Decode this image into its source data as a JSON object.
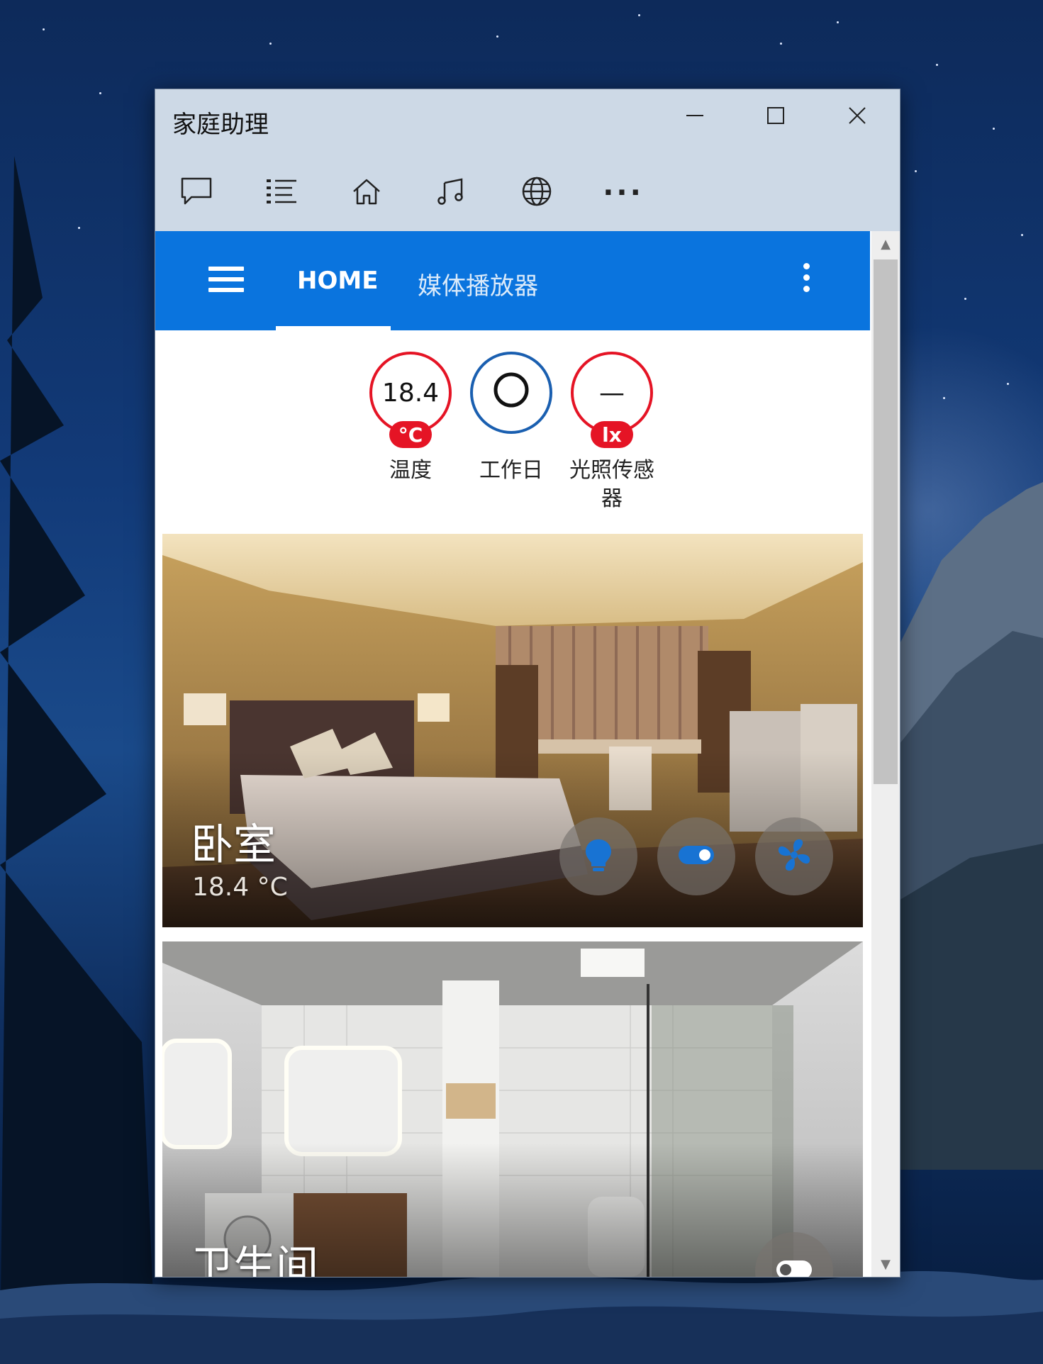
{
  "window": {
    "title": "家庭助理",
    "minimize_icon": "minimize-icon",
    "maximize_icon": "maximize-icon",
    "close_icon": "close-icon"
  },
  "toolbar": [
    {
      "name": "chat-icon"
    },
    {
      "name": "list-icon"
    },
    {
      "name": "home-icon"
    },
    {
      "name": "music-icon"
    },
    {
      "name": "globe-icon"
    },
    {
      "name": "more-icon",
      "glyph": "···"
    }
  ],
  "appbar": {
    "tabs": [
      "HOME",
      "媒体播放器"
    ],
    "active_tab": "HOME",
    "accent": "#0a74de"
  },
  "badges": [
    {
      "value": "18.4",
      "unit": "°C",
      "label": "温度",
      "ring": "#e51425"
    },
    {
      "value": "",
      "unit": "",
      "label": "工作日",
      "ring": "#1a5fb0"
    },
    {
      "value": "—",
      "unit": "lx",
      "label": "光照传感器",
      "ring": "#e51425"
    }
  ],
  "cards": [
    {
      "name": "卧室",
      "temperature": "18.4 °C",
      "actions": [
        "light-bulb-icon",
        "toggle-icon",
        "fan-icon"
      ]
    },
    {
      "name": "卫生间",
      "actions": [
        "toggle-icon"
      ]
    }
  ]
}
